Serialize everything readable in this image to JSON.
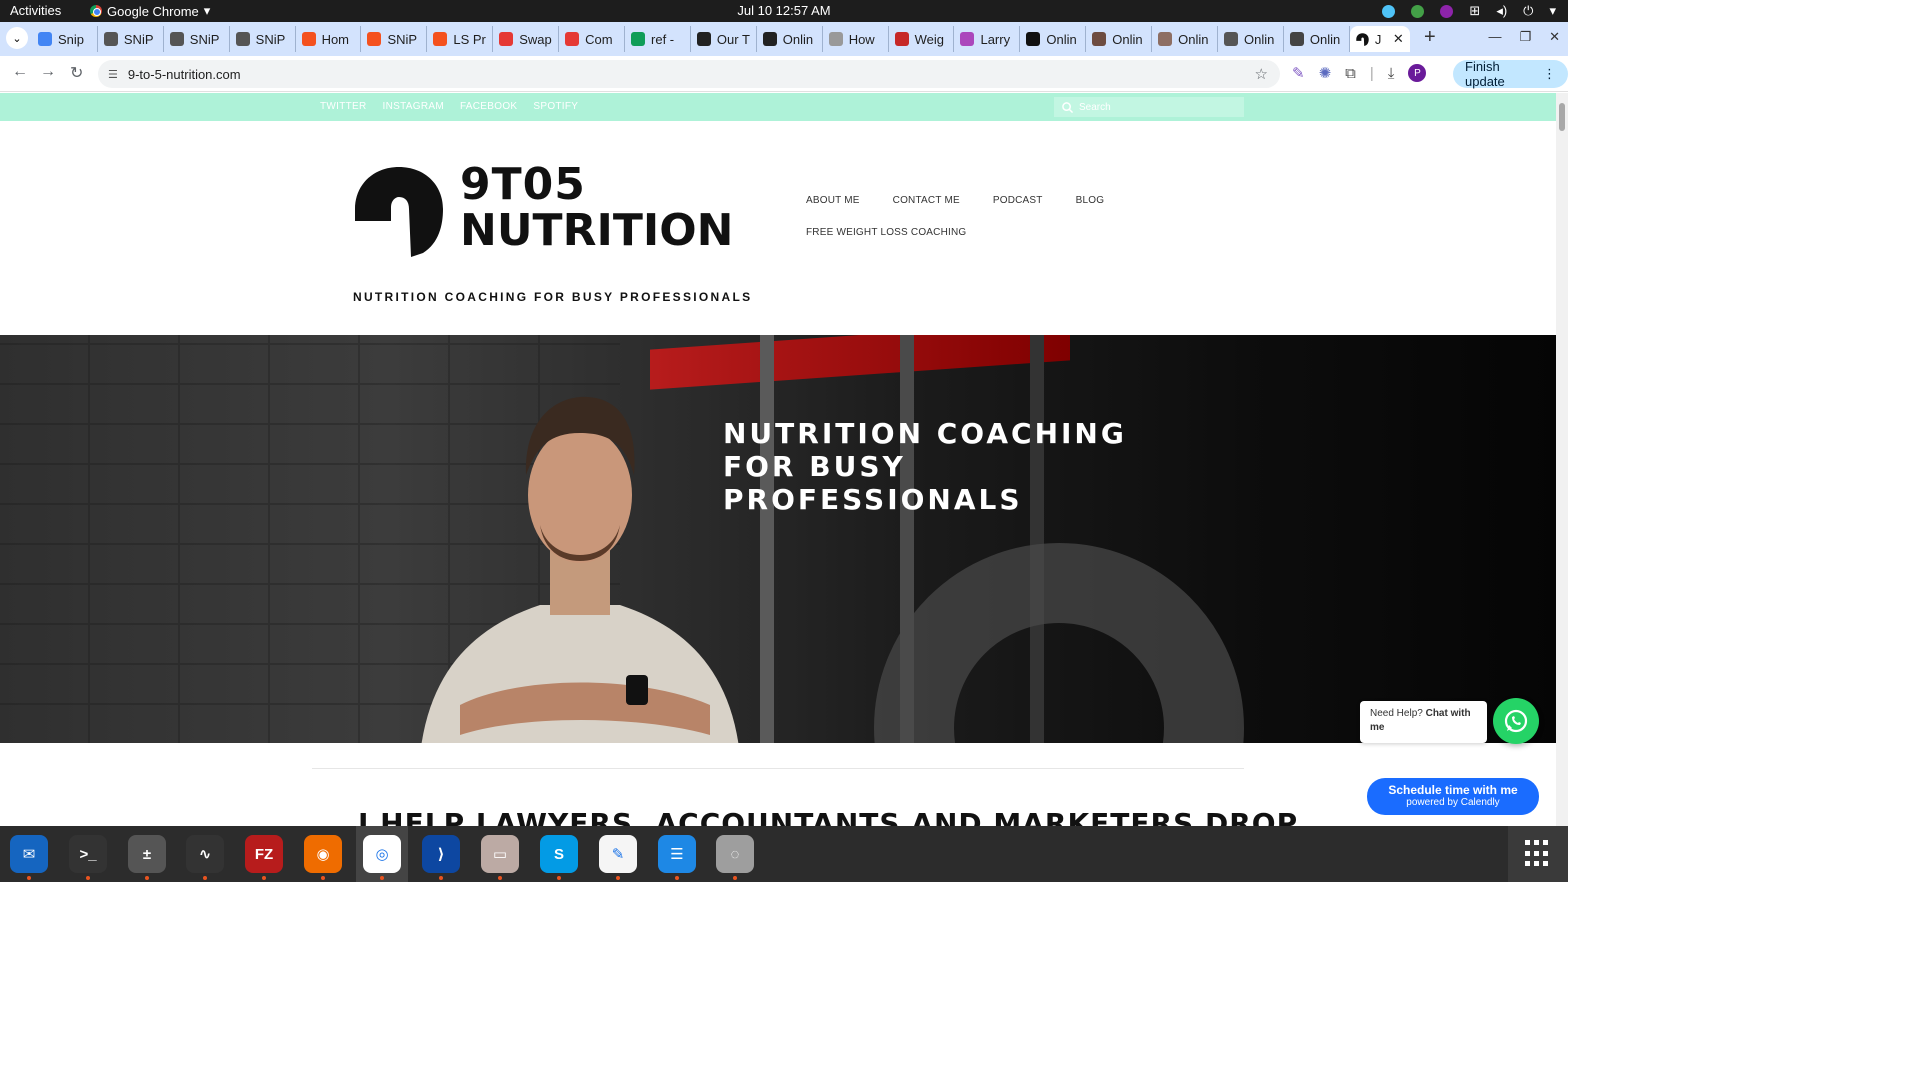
{
  "gnome": {
    "activities": "Activities",
    "app_name": "Google Chrome",
    "clock": "Jul 10  12:57 AM"
  },
  "tabs": [
    {
      "label": "Snip",
      "color": "#4285f4"
    },
    {
      "label": "SNiP",
      "color": "#555555"
    },
    {
      "label": "SNiP",
      "color": "#555555"
    },
    {
      "label": "SNiP",
      "color": "#555555"
    },
    {
      "label": "Hom",
      "color": "#f4511e"
    },
    {
      "label": "SNiP",
      "color": "#f4511e"
    },
    {
      "label": "LS Pr",
      "color": "#f4511e"
    },
    {
      "label": "Swap",
      "color": "#e53935"
    },
    {
      "label": "Com",
      "color": "#e53935"
    },
    {
      "label": "ref -",
      "color": "#0f9d58"
    },
    {
      "label": "Our T",
      "color": "#222222"
    },
    {
      "label": "Onlin",
      "color": "#222222"
    },
    {
      "label": "How",
      "color": "#999999"
    },
    {
      "label": "Weig",
      "color": "#c62828"
    },
    {
      "label": "Larry",
      "color": "#ab47bc"
    },
    {
      "label": "Onlin",
      "color": "#111111"
    },
    {
      "label": "Onlin",
      "color": "#6d4c41"
    },
    {
      "label": "Onlin",
      "color": "#8d6e63"
    },
    {
      "label": "Onlin",
      "color": "#555555"
    },
    {
      "label": "Onlin",
      "color": "#444444"
    }
  ],
  "active_tab": {
    "label": "J"
  },
  "address": {
    "url": "9-to-5-nutrition.com"
  },
  "toolbar": {
    "finish_update": "Finish update",
    "avatar_letter": "P"
  },
  "site": {
    "social": [
      "TWITTER",
      "INSTAGRAM",
      "FACEBOOK",
      "SPOTIFY"
    ],
    "search_placeholder": "Search",
    "logo_line1": "9T05",
    "logo_line2": "NUTRITION",
    "tagline": "NUTRITION COACHING FOR BUSY PROFESSIONALS",
    "nav_row1": [
      "ABOUT ME",
      "CONTACT ME",
      "PODCAST",
      "BLOG"
    ],
    "nav_row2": [
      "FREE WEIGHT LOSS COACHING"
    ],
    "hero_line1": "NUTRITION COACHING",
    "hero_line2": "FOR BUSY",
    "hero_line3": "PROFESSIONALS",
    "headline": "I HELP LAWYERS, ACCOUNTANTS AND MARKETERS DROP"
  },
  "widgets": {
    "chat_prefix": "Need Help?",
    "chat_strong": "Chat with me",
    "calendly_title": "Schedule time with me",
    "calendly_sub": "powered by Calendly"
  },
  "colors": {
    "mint": "#aef2d8",
    "whatsapp": "#25d366",
    "calendly": "#1a6cff"
  },
  "dock_apps": [
    "thunderbird-icon",
    "terminal-icon",
    "calculator-icon",
    "system-monitor-icon",
    "filezilla-icon",
    "firefox-icon",
    "chrome-icon",
    "vscode-icon",
    "files-icon",
    "skype-icon",
    "text-editor-icon",
    "writer-icon",
    "disk-icon"
  ]
}
